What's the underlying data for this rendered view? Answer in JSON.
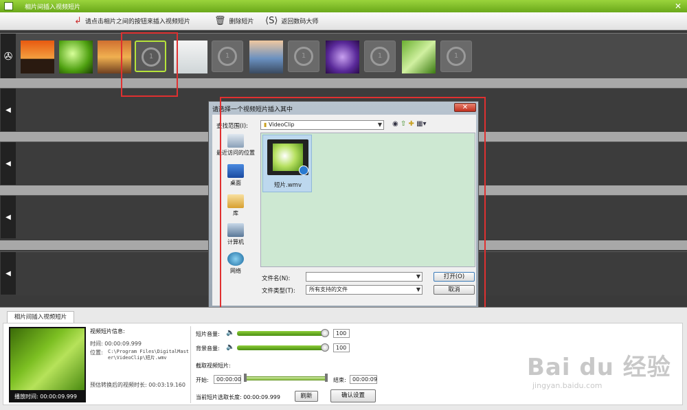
{
  "window": {
    "title": "相片间插入视频短片"
  },
  "toolbar": {
    "hint": "请点击相片之间的按钮来插入视频短片",
    "delete_label": "删除短片",
    "back_label": "返回数码大师"
  },
  "dialog": {
    "title": "请选择一个视频短片插入其中",
    "lookin_label": "查找范围(I):",
    "lookin_value": "VideoClip",
    "places": [
      "最近访问的位置",
      "桌面",
      "库",
      "计算机",
      "网络"
    ],
    "file_name": "短片.wmv",
    "filename_label": "文件名(N):",
    "filetype_label": "文件类型(T):",
    "filetype_value": "所有支持的文件",
    "open_button": "打开(O)",
    "cancel_button": "取消"
  },
  "bottom": {
    "tab": "相片间插入视频短片",
    "preview_time": "播放时间: 00:00:09.999",
    "info_title": "视频短片信息:",
    "time_line": "时间: 00:00:09.999",
    "location_label": "位置:",
    "location_value": "C:\\Program Files\\DigitalMaster\\VideoClip\\短片.wmv",
    "est_label": "预估转换后的视频时长: 00:03:19.160",
    "clip_volume_label": "短片音量:",
    "clip_volume": "100",
    "clip_volume_level": 1.0,
    "bg_volume_label": "背景音量:",
    "bg_volume": "100",
    "bg_volume_level": 1.0,
    "cut_label": "截取视频短片:",
    "start_label": "开始:",
    "start_value": "00:00:00",
    "end_label": "结束:",
    "end_value": "00:00:09",
    "selected_length": "当前短片选取长度: 00:00:09.999",
    "refresh_button": "刷新",
    "confirm_button": "确认设置"
  },
  "watermark": {
    "brand": "Bai du 经验",
    "url": "jingyan.baidu.com"
  }
}
